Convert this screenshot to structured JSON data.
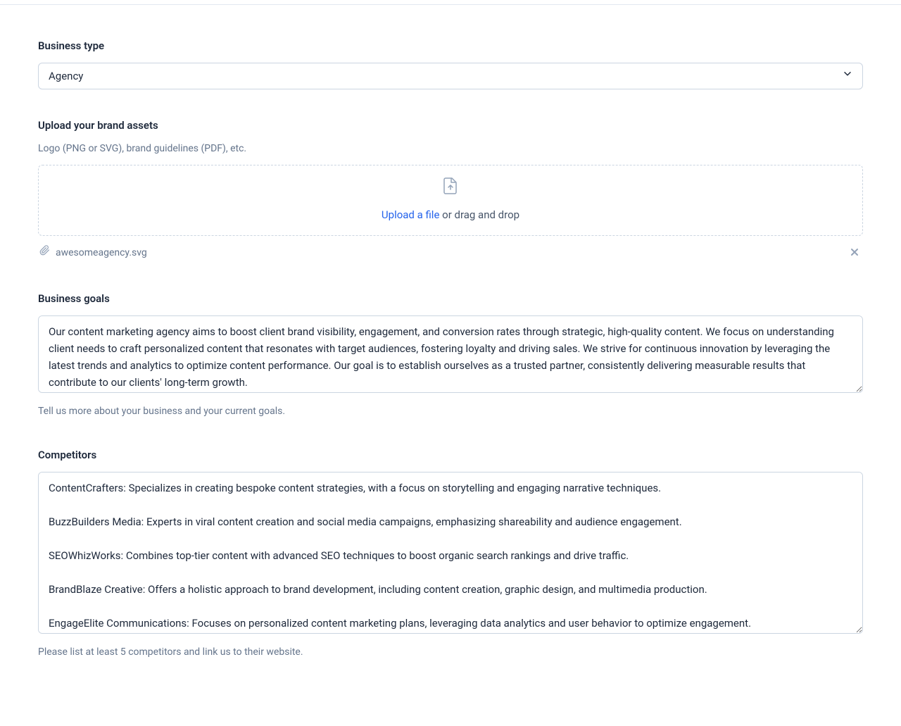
{
  "businessType": {
    "label": "Business type",
    "selected": "Agency"
  },
  "brandAssets": {
    "label": "Upload your brand assets",
    "sublabel": "Logo (PNG or SVG), brand guidelines (PDF), etc.",
    "uploadLinkText": "Upload a file",
    "uploadRestText": " or drag and drop",
    "attachedFile": "awesomeagency.svg"
  },
  "businessGoals": {
    "label": "Business goals",
    "value": "Our content marketing agency aims to boost client brand visibility, engagement, and conversion rates through strategic, high-quality content. We focus on understanding client needs to craft personalized content that resonates with target audiences, fostering loyalty and driving sales. We strive for continuous innovation by leveraging the latest trends and analytics to optimize content performance. Our goal is to establish ourselves as a trusted partner, consistently delivering measurable results that contribute to our clients' long-term growth.",
    "helper": "Tell us more about your business and your current goals."
  },
  "competitors": {
    "label": "Competitors",
    "value": "ContentCrafters: Specializes in creating bespoke content strategies, with a focus on storytelling and engaging narrative techniques.\n\nBuzzBuilders Media: Experts in viral content creation and social media campaigns, emphasizing shareability and audience engagement.\n\nSEOWhizWorks: Combines top-tier content with advanced SEO techniques to boost organic search rankings and drive traffic.\n\nBrandBlaze Creative: Offers a holistic approach to brand development, including content creation, graphic design, and multimedia production.\n\nEngageElite Communications: Focuses on personalized content marketing plans, leveraging data analytics and user behavior to optimize engagement.",
    "helper": "Please list at least 5 competitors and link us to their website."
  }
}
